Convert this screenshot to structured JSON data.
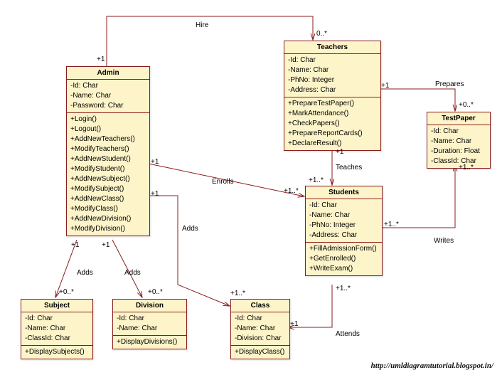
{
  "footer": "http://umldiagramtutorial.blogspot.in/",
  "classes": {
    "admin": {
      "title": "Admin",
      "attrs": [
        "-Id: Char",
        "-Name: Char",
        "-Password: Char"
      ],
      "ops": [
        "+Login()",
        "+Logout()",
        "+AddNewTeachers()",
        "+ModifyTeachers()",
        "+AddNewStudent()",
        "+ModifyStudent()",
        "+AddNewSubject()",
        "+ModifySubject()",
        "+AddNewClass()",
        "+ModifyClass()",
        "+AddNewDivision()",
        "+ModifyDivision()"
      ]
    },
    "teachers": {
      "title": "Teachers",
      "attrs": [
        "-Id: Char",
        "-Name: Char",
        "-PhNo: Integer",
        "-Address: Char"
      ],
      "ops": [
        "+PrepareTestPaper()",
        "+MarkAttendance()",
        "+CheckPapers()",
        "+PrepareReportCards()",
        "+DeclareResult()"
      ]
    },
    "students": {
      "title": "Students",
      "attrs": [
        "-Id: Char",
        "-Name: Char",
        "-PhNo: Integer",
        "-Address: Char"
      ],
      "ops": [
        "+FillAdmissionForm()",
        "+GetEnrolled()",
        "+WriteExam()"
      ]
    },
    "testpaper": {
      "title": "TestPaper",
      "attrs": [
        "-Id: Char",
        "-Name: Char",
        "-Duration: Float",
        "-ClassId: Char"
      ],
      "ops": []
    },
    "subject": {
      "title": "Subject",
      "attrs": [
        "-Id: Char",
        "-Name: Char",
        "-ClassId: Char"
      ],
      "ops": [
        "+DisplaySubjects()"
      ]
    },
    "division": {
      "title": "Division",
      "attrs": [
        "-Id: Char",
        "-Name: Char"
      ],
      "ops": [
        "+DisplayDivisions()"
      ]
    },
    "class": {
      "title": "Class",
      "attrs": [
        "-Id: Char",
        "-Name: Char",
        "-Division: Char"
      ],
      "ops": [
        "+DisplayClass()"
      ]
    }
  },
  "labels": {
    "hire": "Hire",
    "prepares": "Prepares",
    "teaches": "Teaches",
    "enrolls": "Enrolls",
    "adds": "Adds",
    "writes": "Writes",
    "attends": "Attends"
  },
  "mult": {
    "one": "+1",
    "zeroStar": "+0..*",
    "oneStar": "+1..*",
    "zeroStarPlain": "0..*"
  },
  "chart_data": {
    "type": "uml-class-diagram",
    "classes": [
      {
        "name": "Admin",
        "attributes": [
          "Id:Char",
          "Name:Char",
          "Password:Char"
        ],
        "operations": [
          "Login",
          "Logout",
          "AddNewTeachers",
          "ModifyTeachers",
          "AddNewStudent",
          "ModifyStudent",
          "AddNewSubject",
          "ModifySubject",
          "AddNewClass",
          "ModifyClass",
          "AddNewDivision",
          "ModifyDivision"
        ]
      },
      {
        "name": "Teachers",
        "attributes": [
          "Id:Char",
          "Name:Char",
          "PhNo:Integer",
          "Address:Char"
        ],
        "operations": [
          "PrepareTestPaper",
          "MarkAttendance",
          "CheckPapers",
          "PrepareReportCards",
          "DeclareResult"
        ]
      },
      {
        "name": "Students",
        "attributes": [
          "Id:Char",
          "Name:Char",
          "PhNo:Integer",
          "Address:Char"
        ],
        "operations": [
          "FillAdmissionForm",
          "GetEnrolled",
          "WriteExam"
        ]
      },
      {
        "name": "TestPaper",
        "attributes": [
          "Id:Char",
          "Name:Char",
          "Duration:Float",
          "ClassId:Char"
        ],
        "operations": []
      },
      {
        "name": "Subject",
        "attributes": [
          "Id:Char",
          "Name:Char",
          "ClassId:Char"
        ],
        "operations": [
          "DisplaySubjects"
        ]
      },
      {
        "name": "Division",
        "attributes": [
          "Id:Char",
          "Name:Char"
        ],
        "operations": [
          "DisplayDivisions"
        ]
      },
      {
        "name": "Class",
        "attributes": [
          "Id:Char",
          "Name:Char",
          "Division:Char"
        ],
        "operations": [
          "DisplayClass"
        ]
      }
    ],
    "associations": [
      {
        "from": "Admin",
        "to": "Teachers",
        "label": "Hire",
        "fromMult": "1",
        "toMult": "0..*"
      },
      {
        "from": "Admin",
        "to": "Students",
        "label": "Enrolls",
        "fromMult": "1",
        "toMult": "1..*"
      },
      {
        "from": "Admin",
        "to": "Subject",
        "label": "Adds",
        "fromMult": "1",
        "toMult": "0..*"
      },
      {
        "from": "Admin",
        "to": "Division",
        "label": "Adds",
        "fromMult": "1",
        "toMult": "0..*"
      },
      {
        "from": "Admin",
        "to": "Class",
        "label": "Adds",
        "fromMult": "1",
        "toMult": "1..*"
      },
      {
        "from": "Teachers",
        "to": "Students",
        "label": "Teaches",
        "fromMult": "1",
        "toMult": "1..*"
      },
      {
        "from": "Teachers",
        "to": "TestPaper",
        "label": "Prepares",
        "fromMult": "1",
        "toMult": "0..*"
      },
      {
        "from": "Students",
        "to": "TestPaper",
        "label": "Writes",
        "fromMult": "1..*",
        "toMult": "1..*"
      },
      {
        "from": "Students",
        "to": "Class",
        "label": "Attends",
        "fromMult": "1..*",
        "toMult": "1"
      }
    ]
  }
}
